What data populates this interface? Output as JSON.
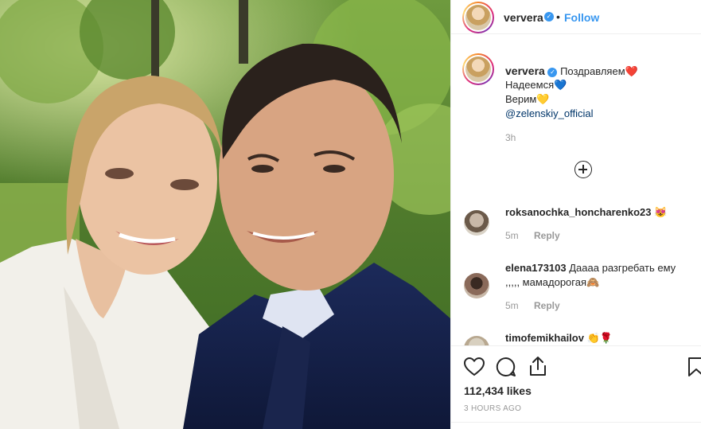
{
  "post": {
    "username": "ververa",
    "verified_mark": "✓",
    "separator": "•",
    "follow_label": "Follow",
    "caption": {
      "username": "ververa",
      "line1": "Поздравляем",
      "line1_emoji": "❤️",
      "line2": "Надеемся",
      "line2_emoji": "💙",
      "line3": "Верим",
      "line3_emoji": "💛",
      "mention": "@zelenskiy_official",
      "time": "3h"
    },
    "comments": [
      {
        "username": "roksanochka_honcharenko23",
        "text": "😻",
        "time": "5m",
        "reply": "Reply"
      },
      {
        "username": "elena173103",
        "text": "Даааа разгребать ему ,,,,, мамадорогая🙈",
        "time": "5m",
        "reply": "Reply"
      },
      {
        "username": "timofemikhailov",
        "text": "👏🌹",
        "time": "",
        "reply": ""
      }
    ],
    "likes": "112,434 likes",
    "posted_ago": "3 HOURS AGO"
  },
  "icons": {
    "like": "heart-icon",
    "comment": "comment-icon",
    "share": "share-icon",
    "save": "bookmark-icon",
    "load_more": "plus-circle-icon"
  },
  "colors": {
    "accent": "#3897f0",
    "text": "#262626",
    "muted": "#999999",
    "border": "#efefef"
  }
}
